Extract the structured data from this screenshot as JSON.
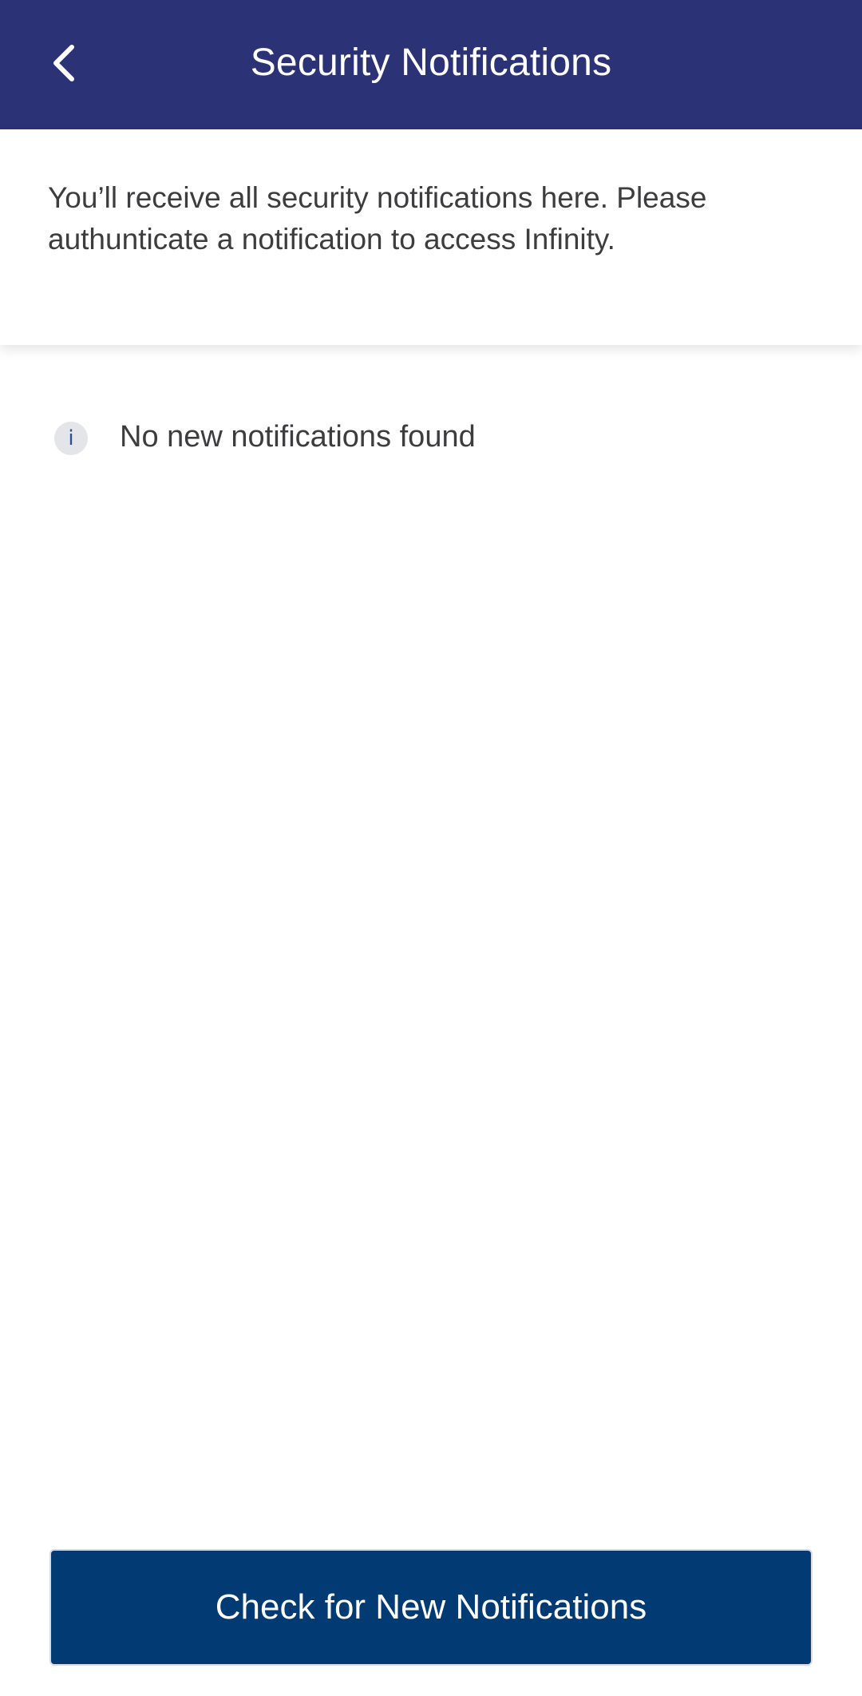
{
  "header": {
    "title": "Security Notifications",
    "back_icon": "chevron-left-icon"
  },
  "intro": {
    "text": "You’ll receive all security notifications here. Please authunticate a notification to access Infinity."
  },
  "empty_state": {
    "icon_glyph": "i",
    "icon": "info-icon",
    "message": "No new notifications found"
  },
  "actions": {
    "check_label": "Check for New Notifications"
  },
  "colors": {
    "header_bg": "#2b3275",
    "button_bg": "#023a73",
    "text": "#3d3d3f"
  }
}
